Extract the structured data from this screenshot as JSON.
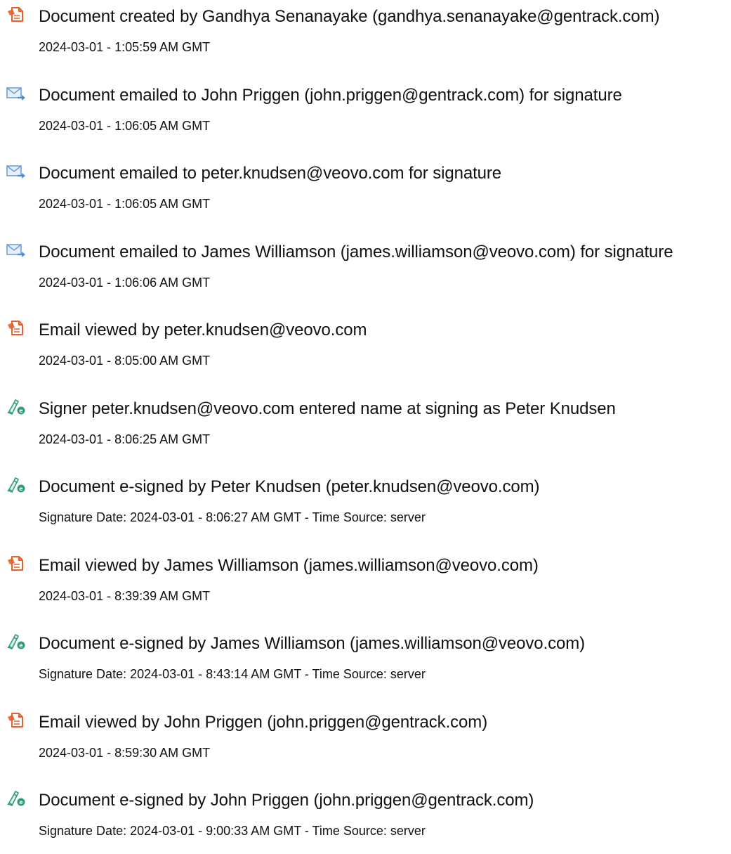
{
  "events": [
    {
      "icon": "document-icon",
      "title": "Document created by Gandhya Senanayake (gandhya.senanayake@gentrack.com)",
      "time": "2024-03-01 - 1:05:59 AM GMT"
    },
    {
      "icon": "email-sent-icon",
      "title": "Document emailed to John Priggen (john.priggen@gentrack.com) for signature",
      "time": "2024-03-01 - 1:06:05 AM GMT"
    },
    {
      "icon": "email-sent-icon",
      "title": "Document emailed to peter.knudsen@veovo.com for signature",
      "time": "2024-03-01 - 1:06:05 AM GMT"
    },
    {
      "icon": "email-sent-icon",
      "title": "Document emailed to James Williamson (james.williamson@veovo.com) for signature",
      "time": "2024-03-01 - 1:06:06 AM GMT"
    },
    {
      "icon": "document-icon",
      "title": "Email viewed by peter.knudsen@veovo.com",
      "time": "2024-03-01 - 8:05:00 AM GMT"
    },
    {
      "icon": "esign-pen-icon",
      "title": "Signer peter.knudsen@veovo.com entered name at signing as Peter Knudsen",
      "time": "2024-03-01 - 8:06:25 AM GMT"
    },
    {
      "icon": "esign-pen-icon",
      "title": "Document e-signed by Peter Knudsen (peter.knudsen@veovo.com)",
      "time": "Signature Date: 2024-03-01 - 8:06:27 AM GMT - Time Source: server"
    },
    {
      "icon": "document-icon",
      "title": "Email viewed by James Williamson (james.williamson@veovo.com)",
      "time": "2024-03-01 - 8:39:39 AM GMT"
    },
    {
      "icon": "esign-pen-icon",
      "title": "Document e-signed by James Williamson (james.williamson@veovo.com)",
      "time": "Signature Date: 2024-03-01 - 8:43:14 AM GMT - Time Source: server"
    },
    {
      "icon": "document-icon",
      "title": "Email viewed by John Priggen (john.priggen@gentrack.com)",
      "time": "2024-03-01 - 8:59:30 AM GMT"
    },
    {
      "icon": "esign-pen-icon",
      "title": "Document e-signed by John Priggen (john.priggen@gentrack.com)",
      "time": "Signature Date: 2024-03-01 - 9:00:33 AM GMT - Time Source: server"
    }
  ],
  "colors": {
    "document_icon": "#e8602c",
    "email_icon": "#4a8ed6",
    "esign_icon": "#2e9c7c"
  }
}
